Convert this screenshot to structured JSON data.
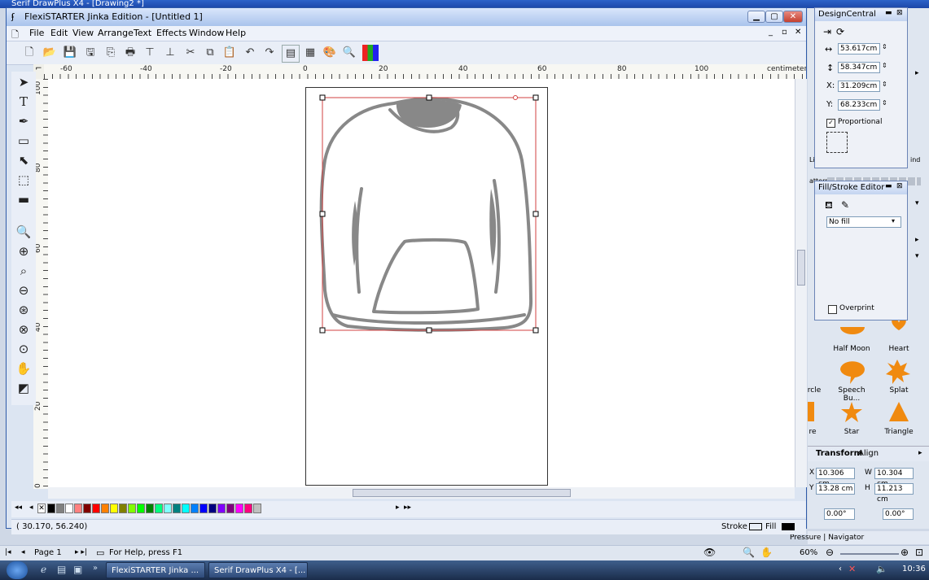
{
  "bg_app": {
    "title": "Serif DrawPlus X4 - [Drawing2 *]",
    "right_panel": {
      "pattern_label": "attern",
      "bind_label": "ind",
      "li_label": "Li",
      "shapes": [
        {
          "label": "Half Moon",
          "icon": "half-moon-icon"
        },
        {
          "label": "Heart",
          "icon": "heart-icon"
        },
        {
          "label": "rcle",
          "icon": "circle-icon"
        },
        {
          "label": "Speech Bu...",
          "icon": "speech-bubble-icon"
        },
        {
          "label": "Splat",
          "icon": "splat-icon"
        },
        {
          "label": "re",
          "icon": "square-icon"
        },
        {
          "label": "Star",
          "icon": "star-icon"
        },
        {
          "label": "Triangle",
          "icon": "triangle-icon"
        }
      ],
      "tabs": [
        "Transform",
        "Align"
      ],
      "transform": {
        "x": "10.306 cm",
        "y": "13.28 cm",
        "w": "10.304 cm",
        "h": "11.213 cm",
        "rot": "0.00°",
        "skew": "0.00°"
      },
      "bottom_tabs": [
        "Pressure",
        "Navigator"
      ],
      "shape_color": "#f08a10"
    },
    "status": {
      "page": "Page 1",
      "help": "For Help, press F1",
      "zoom": "60%"
    }
  },
  "window": {
    "title": "FlexiSTARTER Jinka Edition - [Untitled 1]",
    "menu": [
      "File",
      "Edit",
      "View",
      "Arrange",
      "Text",
      "Effects",
      "Window",
      "Help"
    ],
    "ruler_h": [
      "-60",
      "-40",
      "-20",
      "0",
      "20",
      "40",
      "60",
      "80",
      "100",
      "centimeters"
    ],
    "ruler_v": [
      "100",
      "80",
      "60",
      "40",
      "20",
      "0"
    ],
    "status": {
      "coords": "( 30.170,     56.240)",
      "stroke_label": "Stroke",
      "fill_label": "Fill"
    }
  },
  "design_central": {
    "title": "DesignCentral",
    "width": "53.617cm",
    "height": "58.347cm",
    "x_label": "X:",
    "x": "31.209cm",
    "y_label": "Y:",
    "y": "68.233cm",
    "proportional": "Proportional"
  },
  "fill_stroke": {
    "title": "Fill/Stroke Editor",
    "fill": "No fill",
    "overprint": "Overprint"
  },
  "taskbar": {
    "tasks": [
      "FlexiSTARTER Jinka ...",
      "Serif DrawPlus X4 - [..."
    ],
    "time": "10:36"
  },
  "palette": [
    "#000000",
    "#808080",
    "#ffffff",
    "#ff8080",
    "#800000",
    "#ff0000",
    "#ff8000",
    "#ffff00",
    "#808000",
    "#80ff00",
    "#00ff00",
    "#008000",
    "#00ff80",
    "#80ffff",
    "#008080",
    "#00ffff",
    "#0080ff",
    "#0000ff",
    "#000080",
    "#8000ff",
    "#800080",
    "#ff00ff",
    "#ff0080",
    "#c0c0c0"
  ],
  "colors": {
    "selection": "#d04040",
    "hoodie": "#888888",
    "stroke_swatch": "#ffffff",
    "fill_swatch": "#000000"
  }
}
